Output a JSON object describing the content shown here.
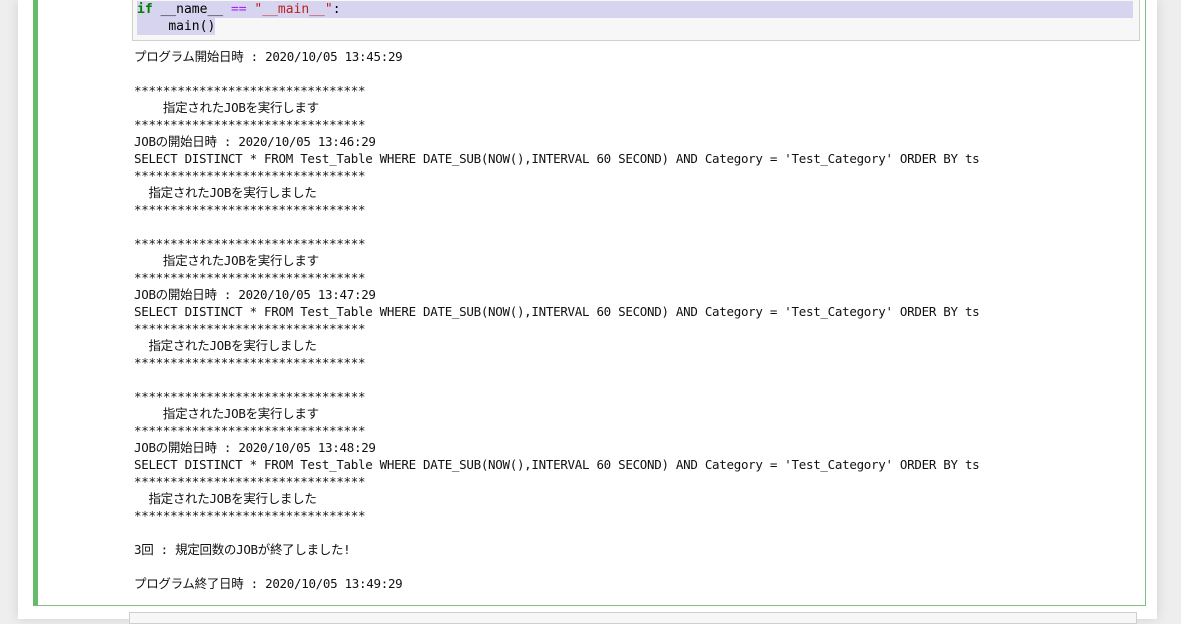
{
  "code": {
    "line1": {
      "kw": "if",
      "name": "__name__",
      "op": "==",
      "str": "\"__main__\"",
      "colon": ":"
    },
    "line2": "main()"
  },
  "output_lines": [
    "プログラム開始日時 : 2020/10/05 13:45:29",
    "",
    "********************************",
    "    指定されたJOBを実行します",
    "********************************",
    "JOBの開始日時 : 2020/10/05 13:46:29",
    "SELECT DISTINCT * FROM Test_Table WHERE DATE_SUB(NOW(),INTERVAL 60 SECOND) AND Category = 'Test_Category' ORDER BY ts",
    "********************************",
    "  指定されたJOBを実行しました",
    "********************************",
    "",
    "********************************",
    "    指定されたJOBを実行します",
    "********************************",
    "JOBの開始日時 : 2020/10/05 13:47:29",
    "SELECT DISTINCT * FROM Test_Table WHERE DATE_SUB(NOW(),INTERVAL 60 SECOND) AND Category = 'Test_Category' ORDER BY ts",
    "********************************",
    "  指定されたJOBを実行しました",
    "********************************",
    "",
    "********************************",
    "    指定されたJOBを実行します",
    "********************************",
    "JOBの開始日時 : 2020/10/05 13:48:29",
    "SELECT DISTINCT * FROM Test_Table WHERE DATE_SUB(NOW(),INTERVAL 60 SECOND) AND Category = 'Test_Category' ORDER BY ts",
    "********************************",
    "  指定されたJOBを実行しました",
    "********************************",
    "",
    "3回 : 規定回数のJOBが終了しました!",
    "",
    "プログラム終了日時 : 2020/10/05 13:49:29"
  ]
}
